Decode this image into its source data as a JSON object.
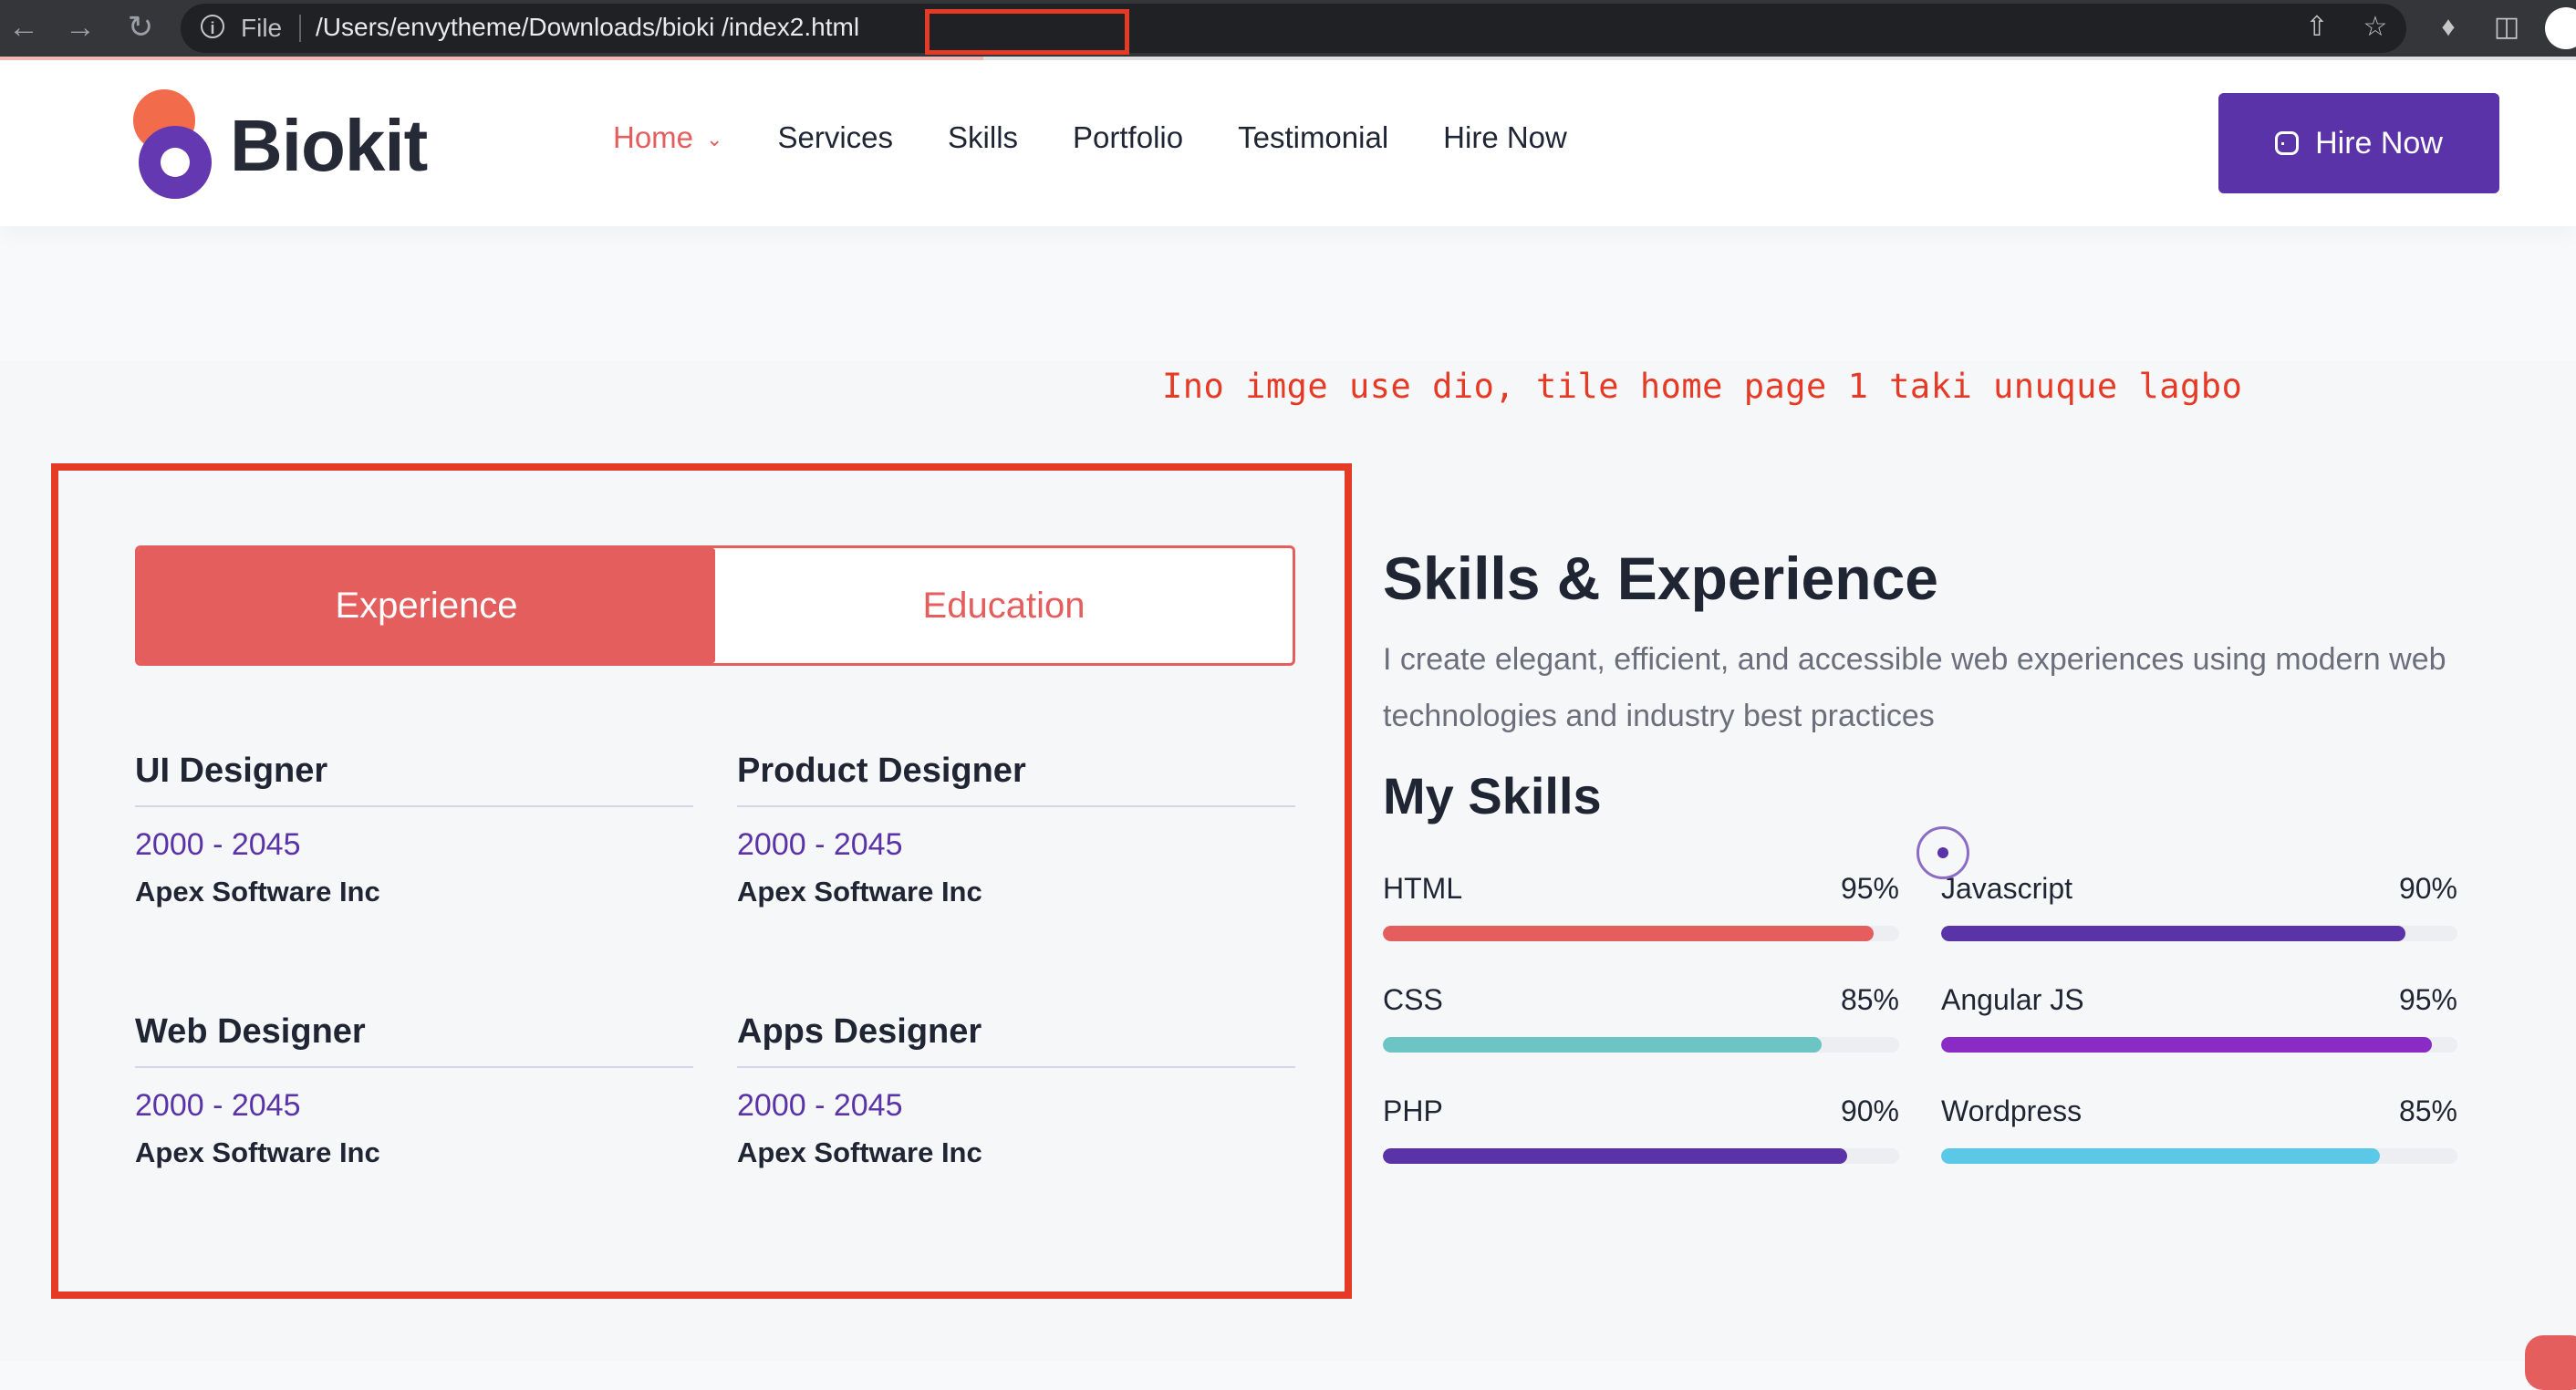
{
  "browser": {
    "scheme_label": "File",
    "url": "/Users/envytheme/Downloads/bioki /index2.html"
  },
  "site": {
    "logo_text": "Biokit",
    "nav": [
      {
        "label": "Home",
        "active": true
      },
      {
        "label": "Services"
      },
      {
        "label": "Skills"
      },
      {
        "label": "Portfolio"
      },
      {
        "label": "Testimonial"
      },
      {
        "label": "Hire Now"
      }
    ],
    "hire_button": "Hire Now",
    "accent": "#e45e5e",
    "brand": "#5a33a8"
  },
  "annotation": "Ino imge use dio, tile home page 1 taki unuque lagbo",
  "resume": {
    "tabs": [
      {
        "label": "Experience",
        "active": true
      },
      {
        "label": "Education",
        "active": false
      }
    ],
    "items": [
      {
        "role": "UI Designer",
        "years": "2000 - 2045",
        "company": "Apex Software Inc"
      },
      {
        "role": "Product Designer",
        "years": "2000 - 2045",
        "company": "Apex Software Inc"
      },
      {
        "role": "Web Designer",
        "years": "2000 - 2045",
        "company": "Apex Software Inc"
      },
      {
        "role": "Apps Designer",
        "years": "2000 - 2045",
        "company": "Apex Software Inc"
      }
    ]
  },
  "skills_section": {
    "heading": "Skills & Experience",
    "description": "I create elegant, efficient, and accessible web experiences using modern web technologies and industry best practices",
    "subheading": "My Skills",
    "skills": [
      {
        "name": "HTML",
        "percent_label": "95%",
        "level": 95,
        "color": "#e45e5e"
      },
      {
        "name": "Javascript",
        "percent_label": "90%",
        "level": 90,
        "color": "#5a33a8"
      },
      {
        "name": "CSS",
        "percent_label": "85%",
        "level": 85,
        "color": "#6cc4c4"
      },
      {
        "name": "Angular JS",
        "percent_label": "95%",
        "level": 95,
        "color": "#8a2bc6"
      },
      {
        "name": "PHP",
        "percent_label": "90%",
        "level": 90,
        "color": "#5a33a8"
      },
      {
        "name": "Wordpress",
        "percent_label": "85%",
        "level": 85,
        "color": "#5cc8e8"
      }
    ]
  }
}
